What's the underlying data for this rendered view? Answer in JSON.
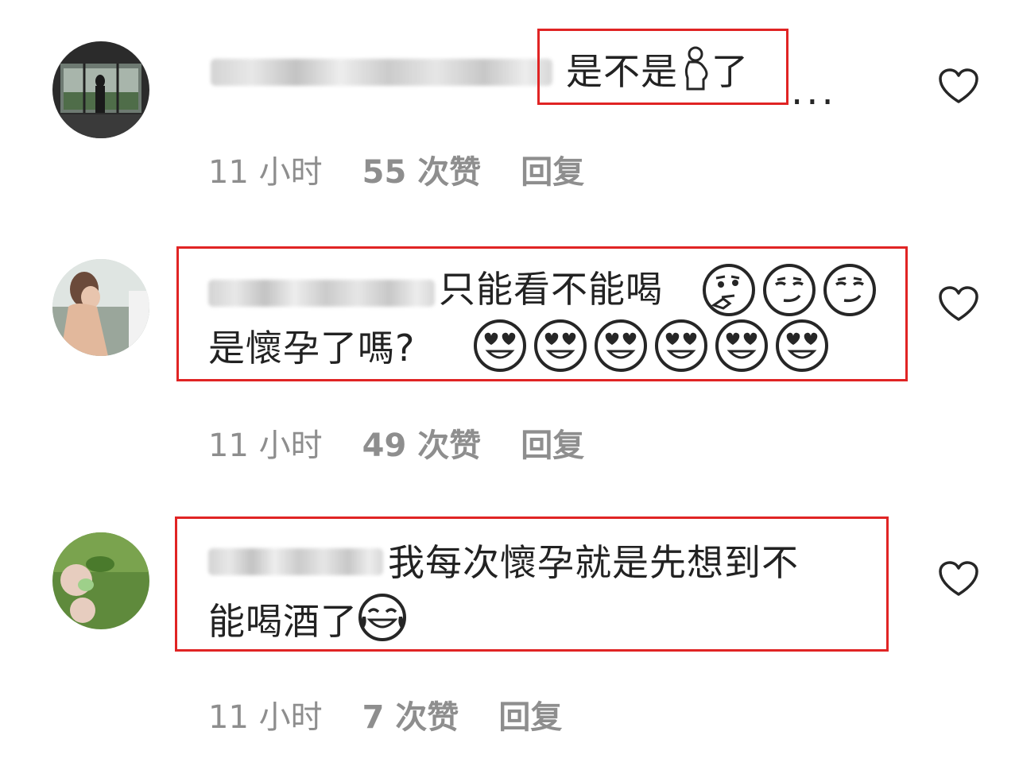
{
  "comments": [
    {
      "text": "是不是",
      "text_tail": "了",
      "more": "...",
      "time": "11 小时",
      "likes": "55 次赞",
      "reply": "回复"
    },
    {
      "text_line1": "只能看不能喝",
      "text_line2": "是懷孕了嗎?",
      "time": "11 小时",
      "likes": "49 次赞",
      "reply": "回复"
    },
    {
      "text_line1": "我每次懷孕就是先想到不",
      "text_line2": "能喝酒了",
      "time": "11 小时",
      "likes": "7 次赞",
      "reply": "回复"
    }
  ],
  "colors": {
    "highlight": "#e02424",
    "meta": "#8e8e8e",
    "text": "#222222"
  },
  "icons": [
    "heart-outline-icon",
    "pregnant-woman-emoji",
    "thinking-face-emoji",
    "smirking-face-emoji",
    "heart-eyes-emoji",
    "tears-of-joy-emoji"
  ]
}
